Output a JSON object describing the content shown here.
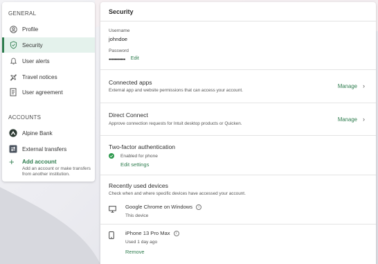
{
  "sidebar": {
    "general_heading": "GENERAL",
    "items": [
      {
        "label": "Profile",
        "icon": "user-circle-icon"
      },
      {
        "label": "Security",
        "icon": "shield-check-icon",
        "active": true
      },
      {
        "label": "User alerts",
        "icon": "bell-icon"
      },
      {
        "label": "Travel notices",
        "icon": "airplane-icon"
      },
      {
        "label": "User agreement",
        "icon": "document-icon"
      }
    ],
    "accounts_heading": "ACCOUNTS",
    "accounts": [
      {
        "label": "Alpine Bank",
        "icon": "bank-logo-icon"
      },
      {
        "label": "External transfers",
        "icon": "transfer-icon"
      }
    ],
    "add_account": {
      "label": "Add account",
      "description": "Add an account or make transfers from another institution."
    }
  },
  "main": {
    "title": "Security",
    "username": {
      "label": "Username",
      "value": "johndoe"
    },
    "password": {
      "label": "Password",
      "value": "•••••••••••",
      "edit_label": "Edit"
    },
    "connected_apps": {
      "title": "Connected apps",
      "description": "External app and website permissions that can access your account.",
      "action": "Manage"
    },
    "direct_connect": {
      "title": "Direct Connect",
      "description": "Approve connection requests for Intuit desktop products or Quicken.",
      "action": "Manage"
    },
    "two_factor": {
      "title": "Two-factor authentication",
      "status": "Enabled for phone",
      "action": "Edit settings"
    },
    "recent_devices": {
      "title": "Recently used devices",
      "description": "Check when and where specific devices have accessed your account.",
      "devices": [
        {
          "name": "Google Chrome on Windows",
          "meta": "This device",
          "icon": "desktop-icon"
        },
        {
          "name": "iPhone 13 Pro Max",
          "meta": "Used 1 day ago",
          "action": "Remove",
          "icon": "phone-icon"
        }
      ]
    }
  },
  "colors": {
    "accent": "#2f7d4f",
    "active_bg": "#e4f2ec"
  }
}
